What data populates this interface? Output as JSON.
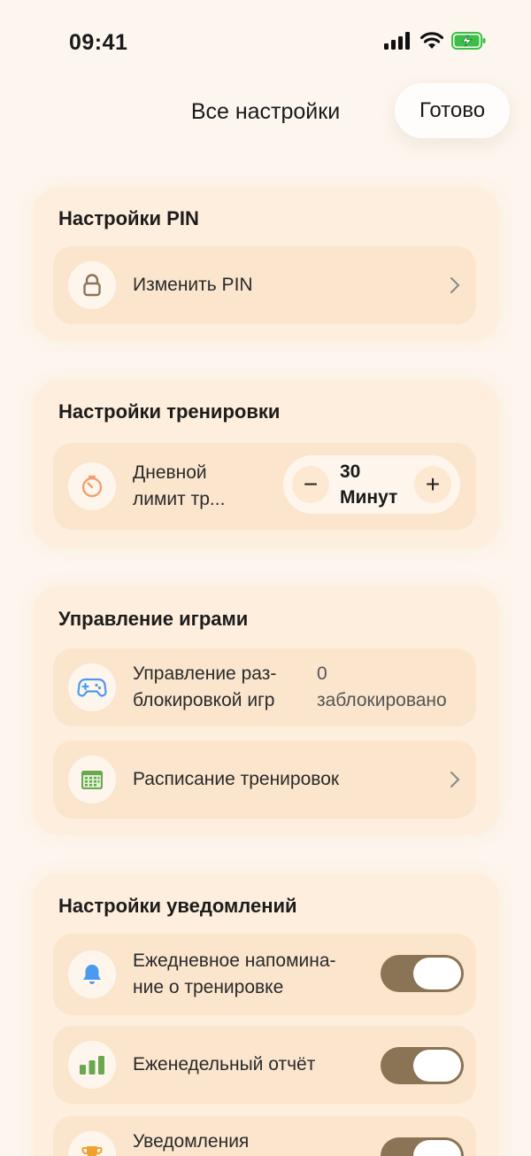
{
  "status": {
    "time": "09:41"
  },
  "header": {
    "title": "Все настройки",
    "done_label": "Готово"
  },
  "pin_section": {
    "title": "Настройки PIN",
    "change_pin": {
      "label": "Изменить PIN",
      "icon": "lock-icon"
    }
  },
  "training_section": {
    "title": "Настройки тренировки",
    "daily_limit": {
      "label_line1": "Дневной",
      "label_line2": "лимит тр...",
      "value": "30",
      "unit": "Минут",
      "minus": "−",
      "plus": "+",
      "icon": "timer-icon"
    }
  },
  "games_section": {
    "title": "Управление играми",
    "unlock_games": {
      "label_line1": "Управление раз-",
      "label_line2": "блокировкой игр",
      "count": "0",
      "count_label": "заблокировано",
      "icon": "gamepad-icon"
    },
    "schedule": {
      "label": "Расписание тренировок",
      "icon": "calendar-icon"
    }
  },
  "notifications_section": {
    "title": "Настройки уведомлений",
    "daily_reminder": {
      "label_line1": "Ежедневное напомина-",
      "label_line2": "ние о тренировке",
      "enabled": true,
      "icon": "bell-icon"
    },
    "weekly_report": {
      "label": "Еженедельный отчёт",
      "enabled": true,
      "icon": "bar-chart-icon"
    },
    "achievements": {
      "label": "Уведомления",
      "enabled": true,
      "icon": "trophy-icon"
    }
  },
  "colors": {
    "background": "#fdf6ef",
    "card": "#fdeedd",
    "row": "#fbe5cd",
    "toggle_on": "#8b7355",
    "accent_blue": "#4a9bf0",
    "accent_green": "#6aa84f",
    "accent_orange": "#f0a060"
  }
}
